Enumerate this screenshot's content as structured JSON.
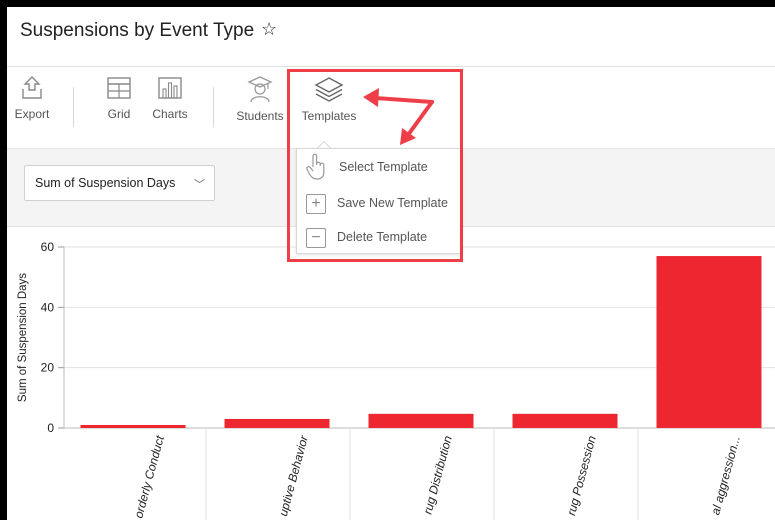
{
  "header": {
    "title": "Suspensions by Event Type",
    "favorite_icon": "star-outline-icon"
  },
  "toolbar": {
    "items": [
      {
        "label": "Export",
        "icon": "export-icon"
      },
      {
        "label": "Grid",
        "icon": "grid-icon"
      },
      {
        "label": "Charts",
        "icon": "bar-chart-icon"
      },
      {
        "label": "Students",
        "icon": "student-icon"
      },
      {
        "label": "Templates",
        "icon": "layers-icon"
      }
    ]
  },
  "filter": {
    "measure": "Sum of Suspension Days"
  },
  "templates_menu": {
    "items": [
      {
        "label": "Select Template",
        "icon": "hand-pointer-icon"
      },
      {
        "label": "Save New Template",
        "icon": "plus-box-icon"
      },
      {
        "label": "Delete Template",
        "icon": "minus-box-icon"
      }
    ]
  },
  "colors": {
    "accent": "#ee3e48",
    "bar": "#ee2630"
  },
  "chart_data": {
    "type": "bar",
    "categories": [
      "orderly Conduct",
      "uptive Behavior",
      "rug Distribution",
      "rug Possession",
      "al aggression..."
    ],
    "values": [
      1,
      3,
      4.7,
      4.7,
      57
    ],
    "ylabel": "Sum of Suspension Days",
    "xlabel": "",
    "yticks": [
      0,
      20,
      40,
      60
    ],
    "ylim": [
      0,
      60
    ]
  }
}
